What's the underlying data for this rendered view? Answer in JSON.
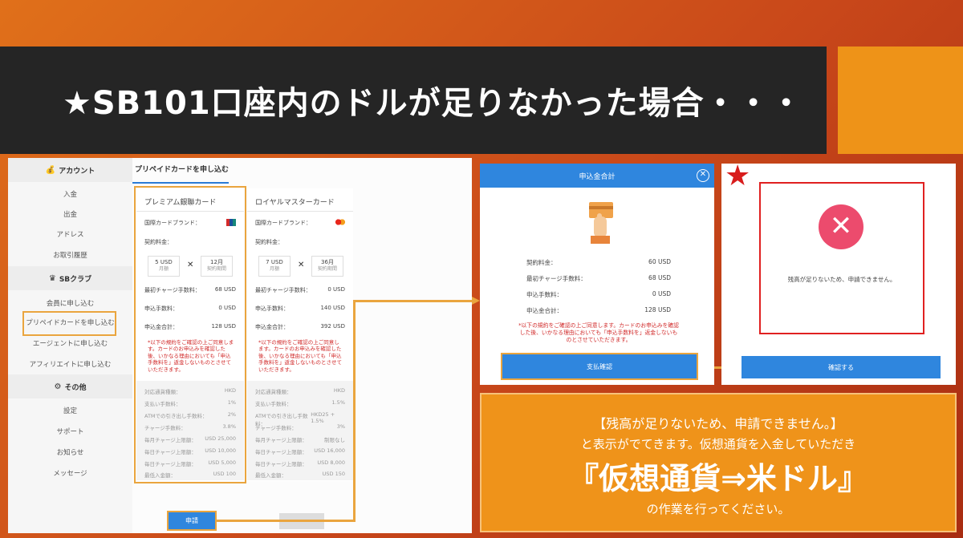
{
  "banner": {
    "title": "★SB101口座内のドルが足りなかった場合・・・"
  },
  "sidebar": {
    "account_header": "アカウント",
    "account_items": [
      "入金",
      "出金",
      "アドレス",
      "お取引履歴"
    ],
    "sbclub_header": "SBクラブ",
    "sbclub_items": [
      "会員に申し込む",
      "プリペイドカードを申し込む",
      "エージェントに申し込む",
      "アフィリエイトに申し込む"
    ],
    "other_header": "その他",
    "other_items": [
      "設定",
      "サポート",
      "お知らせ",
      "メッセージ"
    ]
  },
  "main": {
    "tab": "プリペイドカードを申し込む",
    "card1": {
      "title": "プレミアム銀聯カード",
      "brand_label": "国際カードブランド：",
      "contract_label": "契約料金：",
      "box1_value": "5 USD",
      "box1_sub": "月額",
      "box2_value": "12月",
      "box2_sub": "契約期間",
      "rows": [
        {
          "label": "最初チャージ手数料：",
          "value": "68 USD"
        },
        {
          "label": "申込手数料：",
          "value": "0 USD"
        },
        {
          "label": "申込金合計：",
          "value": "128 USD"
        }
      ],
      "note": "*以下の規約をご確認の上ご同意します。カードのお申込みを確認した後、いかなる理由においても「申込手数料を」返金しないものとさせていただきます。",
      "grey_rows": [
        {
          "label": "対応通貨種類：",
          "value": "HKD"
        },
        {
          "label": "支払い手数料：",
          "value": "1%"
        },
        {
          "label": "ATMでの引き出し手数料：",
          "value": "2%"
        },
        {
          "label": "チャージ手数料：",
          "value": "3.8%"
        },
        {
          "label": "毎月チャージ上限額：",
          "value": "USD 25,000"
        },
        {
          "label": "毎日チャージ上限額：",
          "value": "USD 10,000"
        },
        {
          "label": "毎日チャージ上限額：",
          "value": "USD 5,000"
        },
        {
          "label": "最低入金額：",
          "value": "USD 100"
        }
      ]
    },
    "card2": {
      "title": "ロイヤルマスターカード",
      "brand_label": "国際カードブランド：",
      "contract_label": "契約料金：",
      "box1_value": "7 USD",
      "box1_sub": "月額",
      "box2_value": "36月",
      "box2_sub": "契約期間",
      "rows": [
        {
          "label": "最初チャージ手数料：",
          "value": "0 USD"
        },
        {
          "label": "申込手数料：",
          "value": "140 USD"
        },
        {
          "label": "申込金合計：",
          "value": "392 USD"
        }
      ],
      "note": "*以下の規約をご確認の上ご同意します。カードのお申込みを確認した後、いかなる理由においても「申込手数料を」返金しないものとさせていただきます。",
      "grey_rows": [
        {
          "label": "対応通貨種類：",
          "value": "HKD"
        },
        {
          "label": "支払い手数料：",
          "value": "1.5%"
        },
        {
          "label": "ATMでの引き出し手数料：",
          "value": "HKD25 + 1.5%"
        },
        {
          "label": "チャージ手数料：",
          "value": "3%"
        },
        {
          "label": "毎月チャージ上限額：",
          "value": "制限なし"
        },
        {
          "label": "毎日チャージ上限額：",
          "value": "USD 16,000"
        },
        {
          "label": "毎日チャージ上限額：",
          "value": "USD 8,000"
        },
        {
          "label": "最低入金額：",
          "value": "USD 150"
        }
      ]
    },
    "apply_button": "申請"
  },
  "modal": {
    "title": "申込金合計",
    "rows": [
      {
        "label": "契約料金：",
        "value": "60 USD"
      },
      {
        "label": "最初チャージ手数料：",
        "value": "68 USD"
      },
      {
        "label": "申込手数料：",
        "value": "0 USD"
      },
      {
        "label": "申込金合計：",
        "value": "128 USD"
      }
    ],
    "note": "*以下の規約をご確認の上ご同意します。カードのお申込みを確認した後、いかなる理由においても「申込手数料を」返金しないものとさせていただきます。",
    "pay_button": "支払確認"
  },
  "error_panel": {
    "star": "★",
    "message": "残高が足りないため、申請できません。",
    "confirm_button": "確認する"
  },
  "callout": {
    "line1": "【残高が足りないため、申請できません。】",
    "line2": "と表示がでてきます。仮想通貨を入金していただき",
    "line3": "『仮想通貨⇒米ドル』",
    "line4": "の作業を行ってください。"
  }
}
